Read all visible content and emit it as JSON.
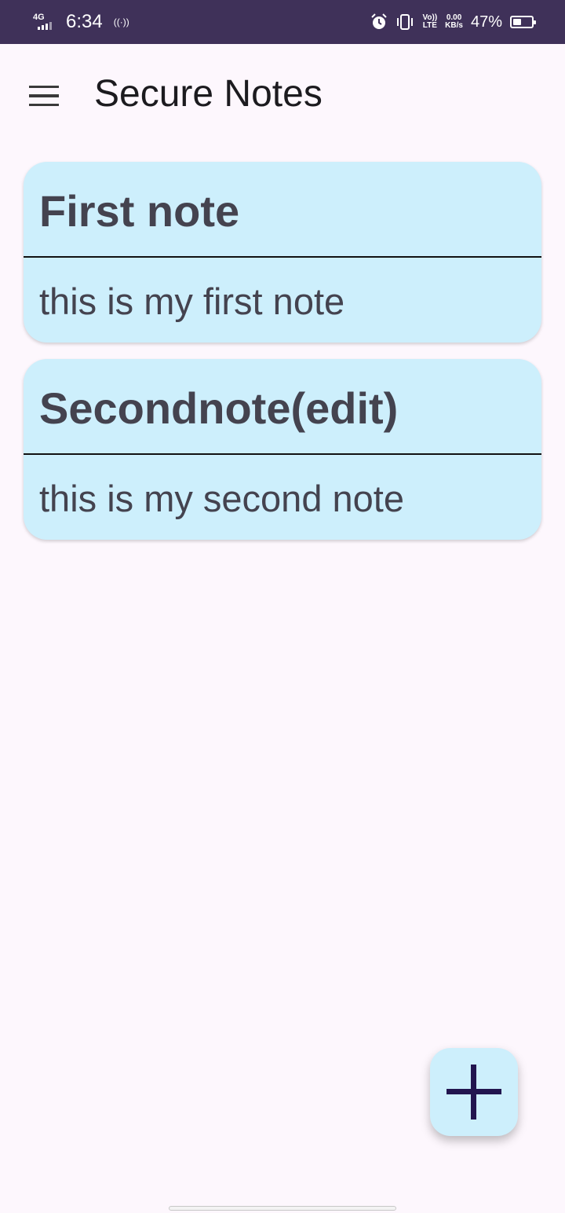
{
  "status_bar": {
    "network": "4G",
    "time": "6:34",
    "hotspot": "((·))",
    "volte_top": "Vo))",
    "volte_bottom": "LTE",
    "speed_top": "0.00",
    "speed_bottom": "KB/s",
    "battery_percent": "47%",
    "battery_level": 0.47
  },
  "app_bar": {
    "title": "Secure Notes",
    "menu_icon": "hamburger-menu-icon"
  },
  "notes": [
    {
      "title": "First note",
      "body": "this is my first note"
    },
    {
      "title": "Secondnote(edit)",
      "body": "this is my second note"
    }
  ],
  "fab": {
    "icon": "plus-icon"
  },
  "colors": {
    "status_bar": "#3f3159",
    "background": "#fdf7fd",
    "card": "#cdeffc",
    "card_text": "#44434f",
    "fab_icon": "#22154f"
  }
}
